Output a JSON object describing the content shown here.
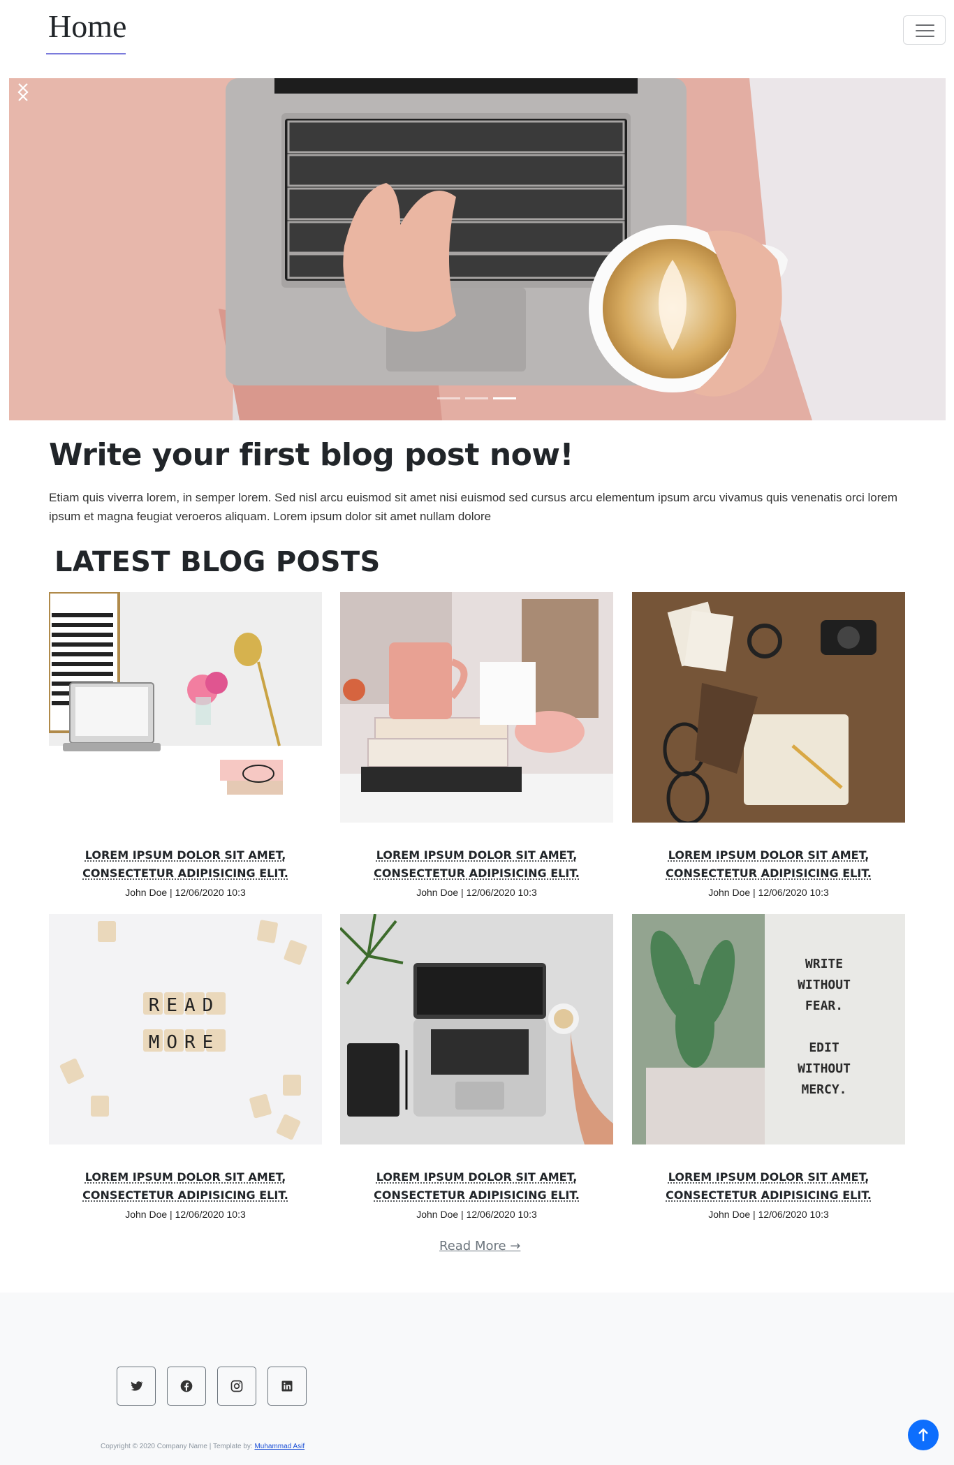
{
  "navbar": {
    "brand": "Home",
    "toggler_icon": "hamburger-icon"
  },
  "carousel": {
    "image": "woman typing on laptop holding latte cup",
    "prev_icon": "chevron-left-icon",
    "next_icon": "chevron-right-icon",
    "slide_count": 3,
    "active_slide": 3
  },
  "intro": {
    "title": "Write your first blog post now!",
    "text": "Etiam quis viverra lorem, in semper lorem. Sed nisl arcu euismod sit amet nisi euismod sed cursus arcu elementum ipsum arcu vivamus quis venenatis orci lorem ipsum et magna feugiat veroeros aliquam. Lorem ipsum dolor sit amet nullam dolore"
  },
  "latest": {
    "heading": "LATEST BLOG POSTS",
    "posts": [
      {
        "title_line1": "LOREM IPSUM DOLOR SIT AMET,",
        "title_line2": "CONSECTETUR ADIPISICING ELIT.",
        "meta": "John Doe | 12/06/2020 10:3"
      },
      {
        "title_line1": "LOREM IPSUM DOLOR SIT AMET,",
        "title_line2": "CONSECTETUR ADIPISICING ELIT.",
        "meta": "John Doe | 12/06/2020 10:3"
      },
      {
        "title_line1": "LOREM IPSUM DOLOR SIT AMET,",
        "title_line2": "CONSECTETUR ADIPISICING ELIT.",
        "meta": "John Doe | 12/06/2020 10:3"
      },
      {
        "title_line1": "LOREM IPSUM DOLOR SIT AMET,",
        "title_line2": "CONSECTETUR ADIPISICING ELIT.",
        "meta": "John Doe | 12/06/2020 10:3"
      },
      {
        "title_line1": "LOREM IPSUM DOLOR SIT AMET,",
        "title_line2": "CONSECTETUR ADIPISICING ELIT.",
        "meta": "John Doe | 12/06/2020 10:3"
      },
      {
        "title_line1": "LOREM IPSUM DOLOR SIT AMET,",
        "title_line2": "CONSECTETUR ADIPISICING ELIT.",
        "meta": "John Doe | 12/06/2020 10:3"
      }
    ],
    "post3_quote": [
      "WRITE",
      "WITHOUT",
      "FEAR.",
      "EDIT",
      "WITHOUT",
      "MERCY."
    ],
    "post0_tiles": [
      "READ",
      "MORE"
    ],
    "read_more": "Read More →"
  },
  "footer": {
    "social_icons": [
      "twitter-icon",
      "facebook-icon",
      "instagram-icon",
      "linkedin-icon"
    ],
    "copyright_prefix": "Copyright © 2020 Company Name | Template by: ",
    "copyright_link": "Muhammad Asif",
    "back_to_top_icon": "arrow-up-icon"
  },
  "colors": {
    "accent": "#0d6efd",
    "brand_underline": "#7b7bdc",
    "footer_bg": "#f8f9fa"
  }
}
